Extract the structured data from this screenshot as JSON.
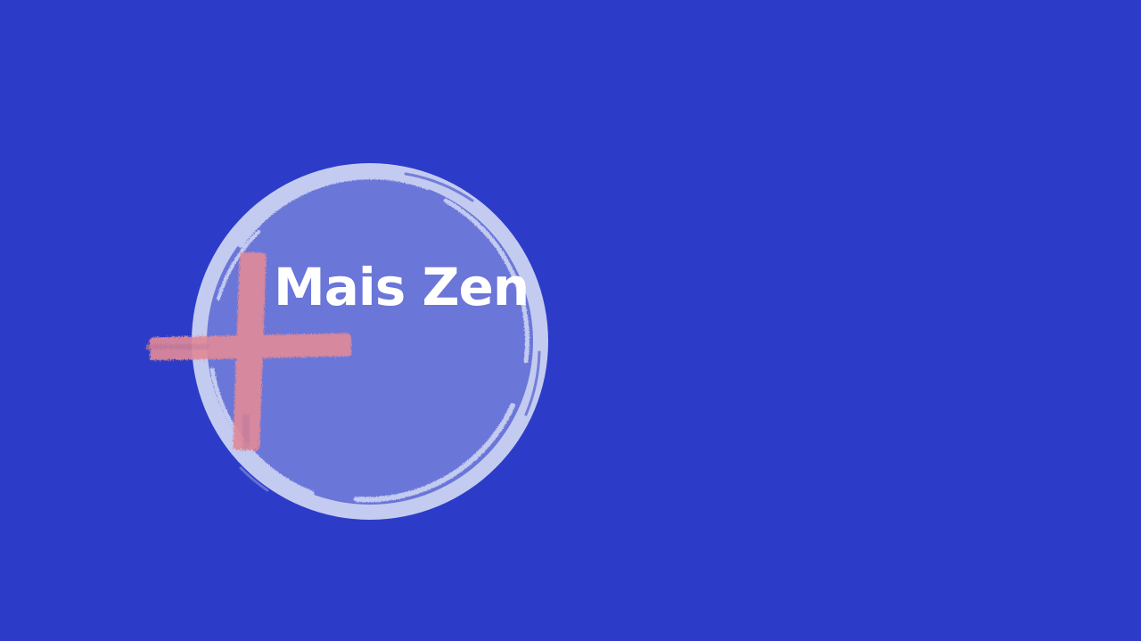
{
  "screen": {
    "background_color": "#2c3cc8"
  },
  "logo": {
    "text": "Mais Zen",
    "text_color": "#ffffff",
    "circle_fill_color": "#6a76d8",
    "circle_rim_color": "#c4cbf0",
    "plus_color": "#e08a9a",
    "plus_icon": "plus-brushstroke-icon"
  }
}
